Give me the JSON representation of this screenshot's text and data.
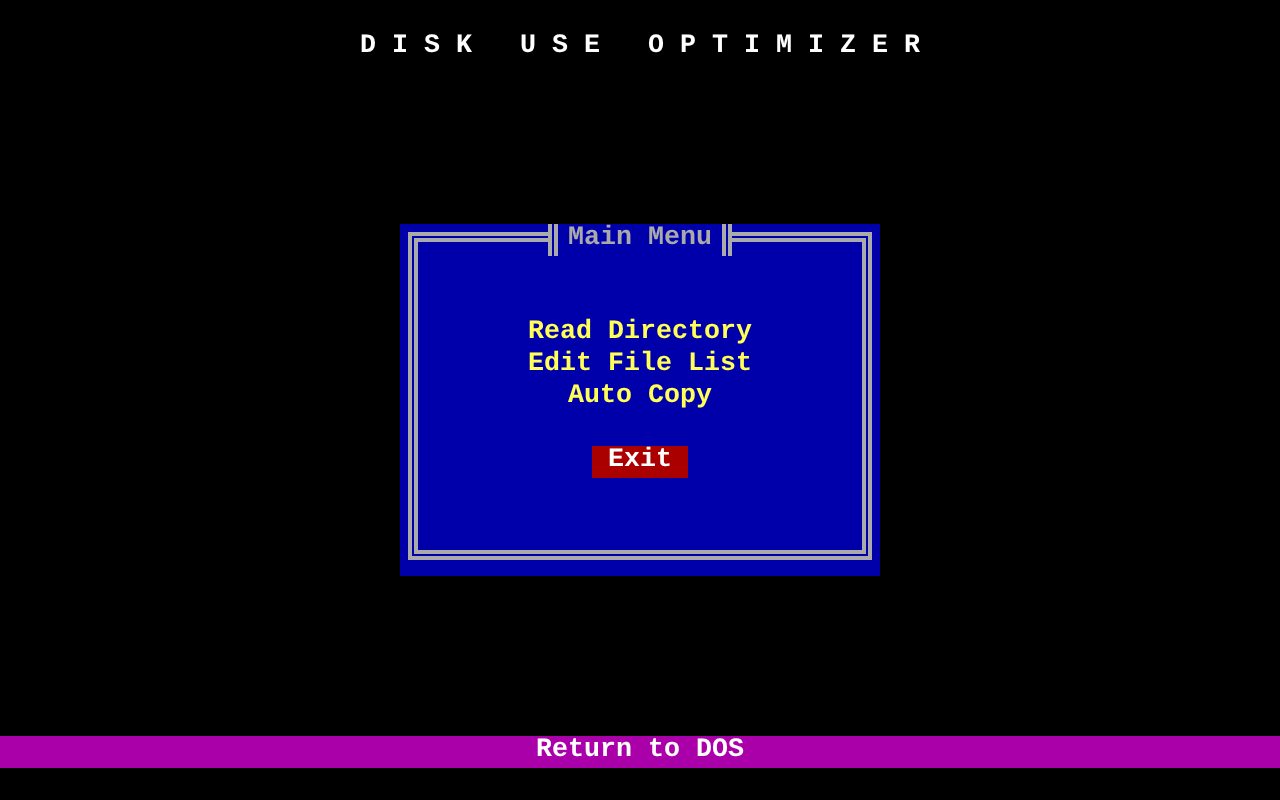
{
  "title": "D I S K   U S E   O P T I M I Z E R",
  "menu": {
    "title": "Main Menu",
    "items": [
      {
        "label": "Read Directory",
        "selected": false
      },
      {
        "label": "Edit File List",
        "selected": false
      },
      {
        "label": "Auto Copy",
        "selected": false
      }
    ],
    "exit": {
      "label": "Exit",
      "selected": true
    }
  },
  "status_bar": "Return to DOS"
}
